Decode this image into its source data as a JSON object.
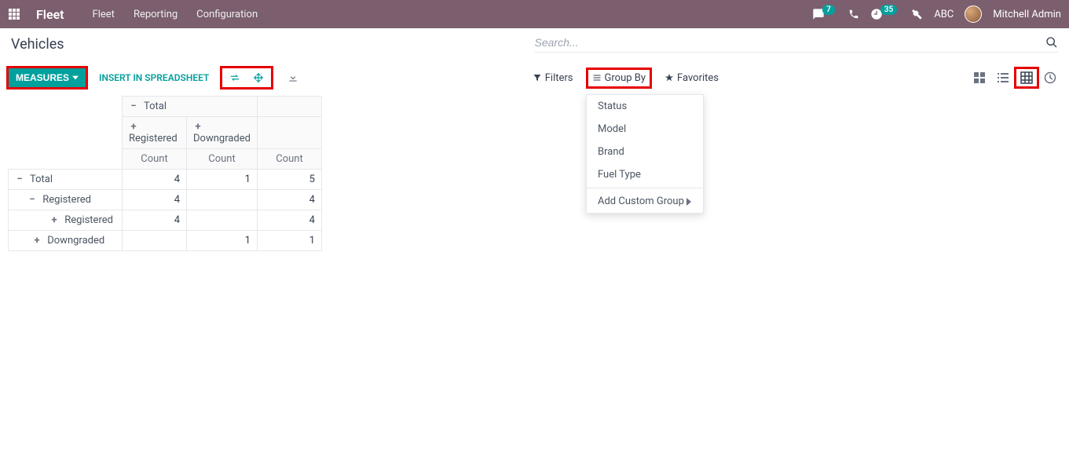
{
  "nav": {
    "brand": "Fleet",
    "links": [
      "Fleet",
      "Reporting",
      "Configuration"
    ],
    "msg_badge": "7",
    "activity_badge": "35",
    "company": "ABC",
    "user": "Mitchell Admin"
  },
  "header": {
    "title": "Vehicles",
    "search_placeholder": "Search..."
  },
  "toolbar": {
    "measures": "MEASURES",
    "insert": "INSERT IN SPREADSHEET",
    "filters": "Filters",
    "group_by": "Group By",
    "favorites": "Favorites"
  },
  "groupby_menu": {
    "items": [
      "Status",
      "Model",
      "Brand",
      "Fuel Type"
    ],
    "custom": "Add Custom Group"
  },
  "pivot": {
    "col_total": "Total",
    "col1": "Registered",
    "col2": "Downgraded",
    "count": "Count",
    "rows": {
      "total": {
        "label": "Total",
        "registered": "4",
        "downgraded": "1",
        "total": "5"
      },
      "r1": {
        "label": "Registered",
        "registered": "4",
        "downgraded": "",
        "total": "4"
      },
      "r1a": {
        "label": "Registered",
        "registered": "4",
        "downgraded": "",
        "total": "4"
      },
      "r2": {
        "label": "Downgraded",
        "registered": "",
        "downgraded": "1",
        "total": "1"
      }
    }
  }
}
